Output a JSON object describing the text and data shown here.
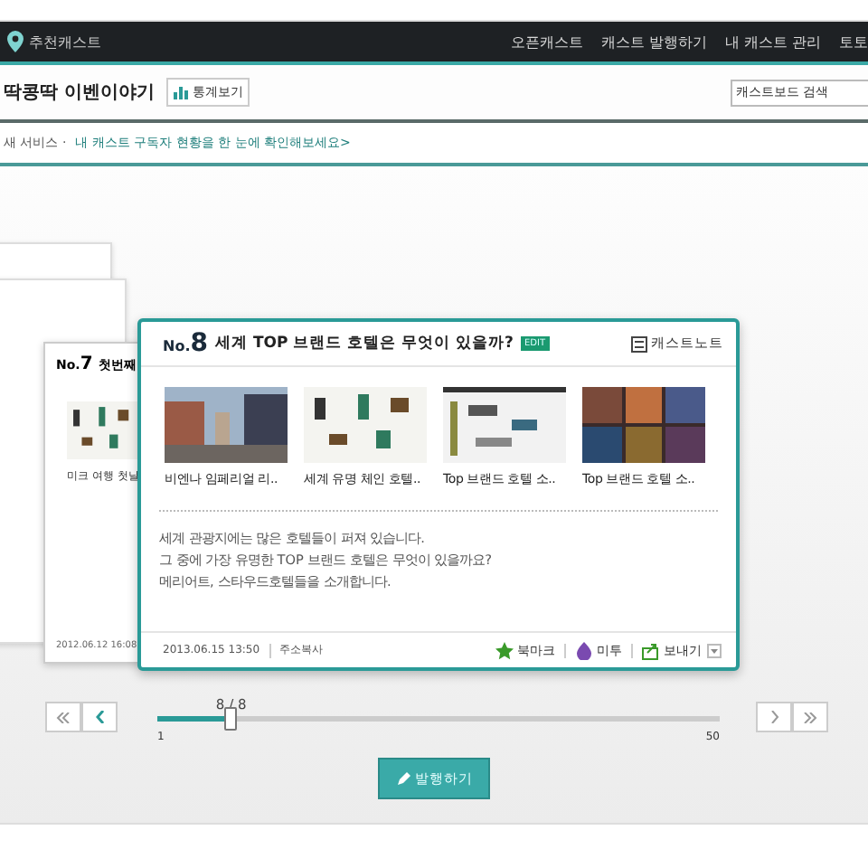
{
  "nav": {
    "logo": "추천캐스트",
    "links": [
      "오픈캐스트",
      "캐스트 발행하기",
      "내 캐스트 관리",
      "토토"
    ]
  },
  "header": {
    "title": "딱콩딱 이벤이야기",
    "stats_button": "통계보기",
    "search": {
      "placeholder": "캐스트보드 검색"
    }
  },
  "notice": {
    "label": "새 서비스 ·",
    "link": "내 캐스트 구독자 현황을 한 눈에 확인해보세요>"
  },
  "back_card": {
    "number_prefix": "No.",
    "number": "7",
    "title": "첫번째",
    "caption": "미크 여행 첫날",
    "date": "2012.06.12 16:08"
  },
  "card": {
    "number_prefix": "No.",
    "number": "8",
    "title": "세계 TOP 브랜드 호텔은 무엇이 있을까?",
    "badge": "EDIT",
    "note": "캐스트노트",
    "items": [
      {
        "caption": "비엔나 임페리얼 리.."
      },
      {
        "caption": "세계 유명 체인 호텔.."
      },
      {
        "caption": "Top 브랜드 호텔 소.."
      },
      {
        "caption": "Top 브랜드 호텔 소.."
      }
    ],
    "body": [
      "세계 관광지에는 많은 호텔들이 퍼져 있습니다.",
      "그 중에 가장 유명한 TOP 브랜드 호텔은 무엇이 있을까요?",
      "메리어트, 스타우드호텔들을 소개합니다."
    ],
    "date": "2013.06.15 13:50",
    "copy": "주소복사",
    "actions": [
      {
        "kind": "bookmark",
        "label": "북마크"
      },
      {
        "kind": "me2",
        "label": "미투"
      },
      {
        "kind": "send",
        "label": "보내기"
      }
    ]
  },
  "pager": {
    "reading": "8 / 8",
    "level": 0.13,
    "min": "1",
    "max": "50"
  },
  "publish_button": "발행하기"
}
